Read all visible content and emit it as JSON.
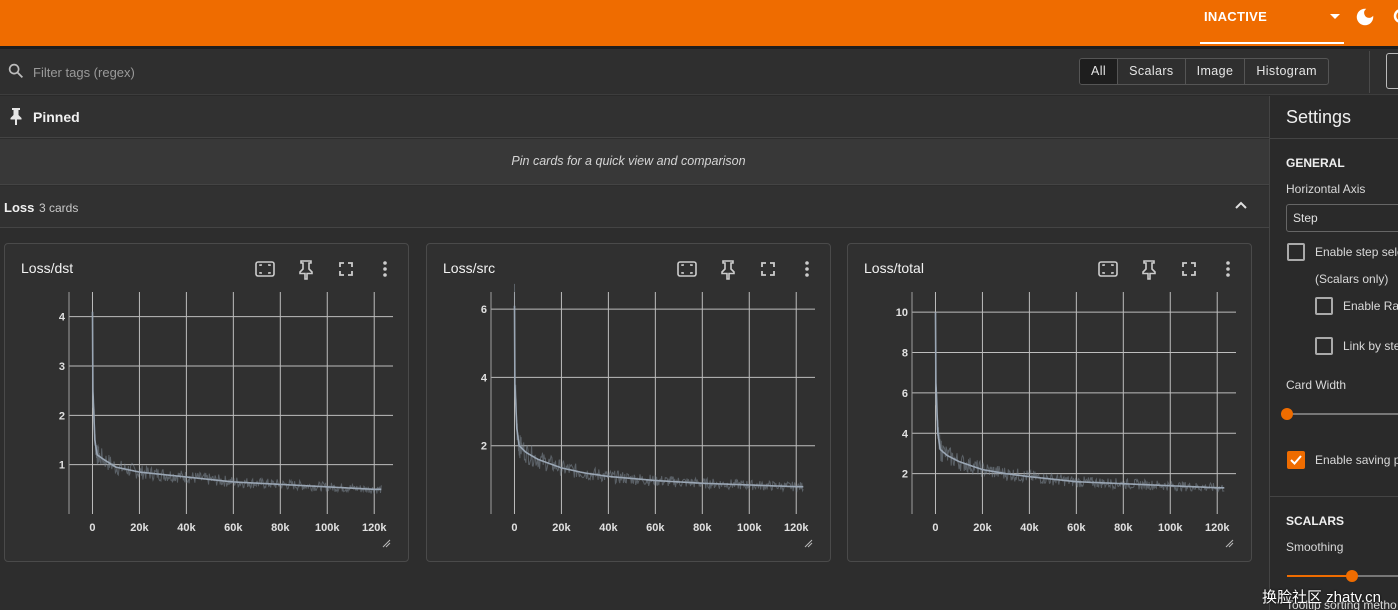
{
  "header": {
    "mode_label": "INACTIVE",
    "colors": {
      "brand": "#ef6c00"
    },
    "icons": [
      "chevron-down-icon",
      "dark-mode-moon-icon"
    ]
  },
  "filter": {
    "placeholder": "Filter tags (regex)",
    "types": [
      "All",
      "Scalars",
      "Image",
      "Histogram"
    ],
    "active_type": "All"
  },
  "pinned": {
    "label": "Pinned",
    "empty_message": "Pin cards for a quick view and comparison"
  },
  "group": {
    "name": "Loss",
    "count_label": "3 cards"
  },
  "cards": [
    {
      "title": "Loss/dst"
    },
    {
      "title": "Loss/src"
    },
    {
      "title": "Loss/total"
    }
  ],
  "chart_data": [
    {
      "type": "line",
      "title": "Loss/dst",
      "x_ticks": [
        "0",
        "20k",
        "40k",
        "60k",
        "80k",
        "100k",
        "120k"
      ],
      "y_ticks": [
        "1",
        "2",
        "3",
        "4"
      ],
      "xlim": [
        -10000,
        128000
      ],
      "ylim": [
        0,
        4.5
      ],
      "grid": true,
      "series": [
        {
          "x": [
            0,
            200,
            1000,
            2000,
            5000,
            10000,
            20000,
            30000,
            40000,
            60000,
            80000,
            100000,
            120000,
            123000
          ],
          "y": [
            4.1,
            2.5,
            1.5,
            1.2,
            1.1,
            0.95,
            0.85,
            0.8,
            0.75,
            0.65,
            0.6,
            0.55,
            0.5,
            0.5
          ]
        }
      ]
    },
    {
      "type": "line",
      "title": "Loss/src",
      "x_ticks": [
        "0",
        "20k",
        "40k",
        "60k",
        "80k",
        "100k",
        "120k"
      ],
      "y_ticks": [
        "2",
        "4",
        "6"
      ],
      "xlim": [
        -10000,
        128000
      ],
      "ylim": [
        0,
        6.5
      ],
      "grid": true,
      "series": [
        {
          "x": [
            0,
            200,
            1000,
            2000,
            5000,
            10000,
            20000,
            30000,
            40000,
            60000,
            80000,
            100000,
            120000,
            123000
          ],
          "y": [
            6.1,
            3.8,
            2.5,
            2.0,
            1.8,
            1.6,
            1.35,
            1.2,
            1.1,
            0.98,
            0.9,
            0.85,
            0.8,
            0.8
          ]
        }
      ]
    },
    {
      "type": "line",
      "title": "Loss/total",
      "x_ticks": [
        "0",
        "20k",
        "40k",
        "60k",
        "80k",
        "100k",
        "120k"
      ],
      "y_ticks": [
        "2",
        "4",
        "6",
        "8",
        "10"
      ],
      "xlim": [
        -10000,
        128000
      ],
      "ylim": [
        0,
        11
      ],
      "grid": true,
      "series": [
        {
          "x": [
            0,
            200,
            1000,
            2000,
            5000,
            10000,
            20000,
            30000,
            40000,
            60000,
            80000,
            100000,
            120000,
            123000
          ],
          "y": [
            10.0,
            6.5,
            4.0,
            3.2,
            2.9,
            2.6,
            2.2,
            2.0,
            1.85,
            1.6,
            1.5,
            1.4,
            1.3,
            1.3
          ]
        }
      ]
    }
  ],
  "settings": {
    "title": "Settings",
    "general_label": "GENERAL",
    "horizontal_axis_label": "Horizontal Axis",
    "horizontal_axis_value": "Step",
    "enable_step_label": "Enable step sele",
    "scalars_only_label": "(Scalars only)",
    "enable_range_label": "Enable Ran",
    "link_by_step_label": "Link by ste",
    "card_width_label": "Card Width",
    "card_width_level": 0,
    "enable_saving_label": "Enable saving p",
    "enable_saving_checked": true,
    "scalars_label": "SCALARS",
    "smoothing_label": "Smoothing",
    "smoothing_level": 0.5,
    "tooltip_label": "Tooltip sorting metho"
  },
  "watermark": "换脸社区 zhatv.cn"
}
